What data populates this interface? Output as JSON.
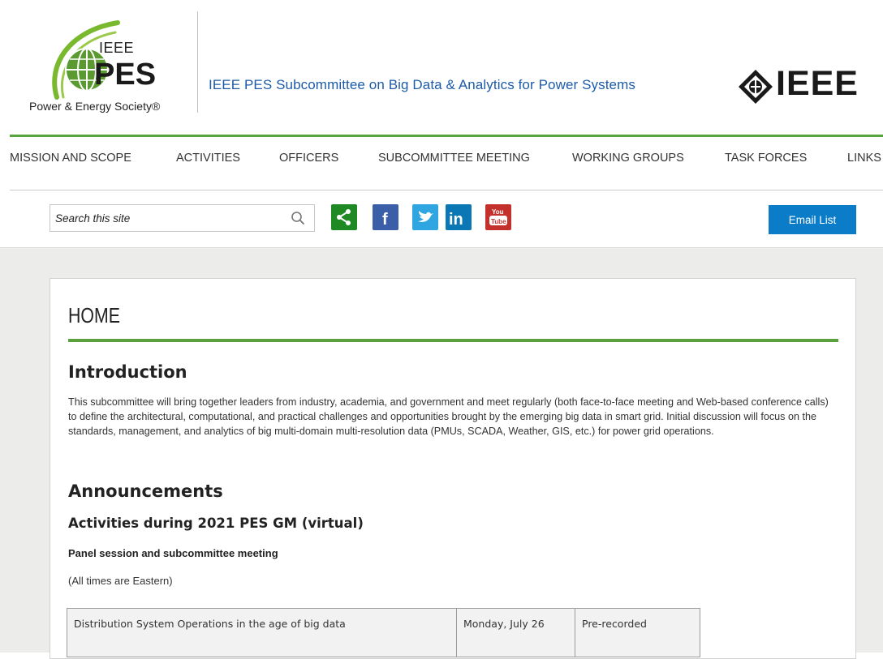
{
  "header": {
    "logo": {
      "org_top": "IEEE",
      "org_main": "PES",
      "caption": "Power & Energy Society®"
    },
    "site_title": "IEEE PES Subcommittee on Big Data & Analytics for Power Systems",
    "ieee_word": "IEEE",
    "colors": {
      "title_blue": "#1d5ba8",
      "accent_green": "#56a33f"
    }
  },
  "nav": {
    "items": [
      {
        "label": "MISSION AND SCOPE"
      },
      {
        "label": "ACTIVITIES"
      },
      {
        "label": "OFFICERS"
      },
      {
        "label": "SUBCOMMITTEE MEETING"
      },
      {
        "label": "WORKING GROUPS"
      },
      {
        "label": "TASK FORCES"
      },
      {
        "label": "LINKS"
      }
    ]
  },
  "toolbar": {
    "search_placeholder": "Search this site",
    "social_icons": [
      "share-icon",
      "facebook-icon",
      "twitter-icon",
      "linkedin-icon",
      "youtube-icon"
    ],
    "email_button": "Email List",
    "colors": {
      "share": "#1f8a24",
      "facebook": "#3b5ea8",
      "twitter": "#2fa6e1",
      "linkedin": "#0b77b5",
      "youtube": "#c4302b",
      "email": "#0b7cc8"
    }
  },
  "main": {
    "page_title": "HOME",
    "intro_heading": "Introduction",
    "intro_text": "This subcommittee will bring together leaders from industry, academia, and government and meet regularly (both face-to-face meeting and Web-based conference calls) to define the architectural, computational, and practical challenges and opportunities brought by the emerging big data in smart grid. Initial discussion will focus on the standards, management, and analytics of big multi-domain multi-resolution data (PMUs, SCADA, Weather, GIS, etc.) for power grid operations.",
    "announcements_heading": "Announcements",
    "activities_heading": "Activities during 2021 PES GM (virtual)",
    "panel_heading": "Panel session and subcommittee meeting",
    "times_note": "(All times are Eastern)",
    "schedule": [
      {
        "session": "Distribution System Operations in the age of big data",
        "date": "Monday, July 26",
        "time": "Pre-recorded"
      }
    ]
  }
}
